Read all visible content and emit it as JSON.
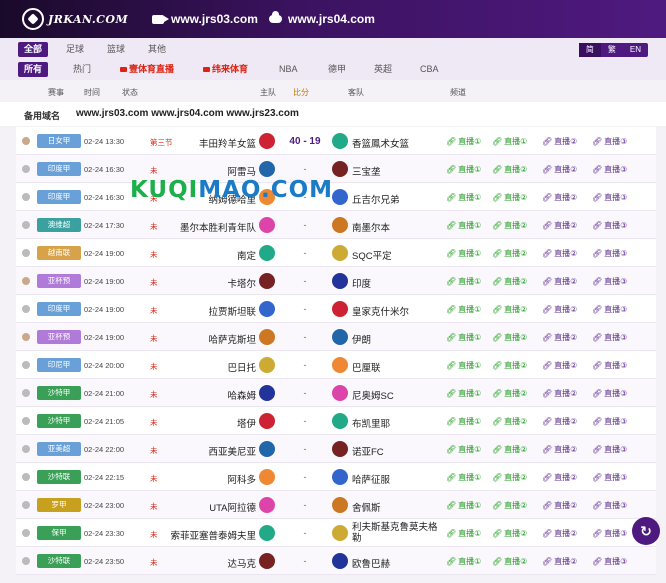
{
  "header": {
    "logo_text": "JRKAN.COM",
    "links": [
      {
        "icon": "video-camera-icon",
        "text": "www.jrs03.com"
      },
      {
        "icon": "cloud-icon",
        "text": "www.jrs04.com"
      }
    ]
  },
  "nav": {
    "sport_tabs": [
      "全部",
      "足球",
      "篮球",
      "其他"
    ],
    "sport_active": 0,
    "filter_tabs": [
      "所有",
      "热门",
      "壹体育直播",
      "纬来体育",
      "NBA",
      "德甲",
      "英超",
      "CBA"
    ],
    "lang": [
      "简",
      "繁",
      "EN"
    ]
  },
  "table": {
    "headers": [
      "赛事",
      "时间",
      "状态",
      "主队",
      "比分",
      "客队",
      "频道"
    ],
    "domains_label": "备用域名",
    "domains_value": "www.jrs03.com www.jrs04.com www.jrs23.com",
    "rows": [
      {
        "league": "日女甲",
        "color": "#6aa0d8",
        "time": "02-24 13:30",
        "status": "第三节",
        "home": "丰田羚羊女篮",
        "score": "40 - 19",
        "away": "香篮鳳术女篮",
        "live": true,
        "ball": "b",
        "links": [
          "直播①",
          "直播①",
          "直播②",
          "直播③"
        ]
      },
      {
        "league": "印度甲",
        "color": "#6aa0d8",
        "time": "02-24 16:30",
        "status": "未",
        "home": "阿雷马",
        "score": "-",
        "away": "三宝垄",
        "ball": "f",
        "links": [
          "直播①",
          "直播②",
          "直播②",
          "直播③"
        ]
      },
      {
        "league": "印度甲",
        "color": "#6aa0d8",
        "time": "02-24 16:30",
        "status": "未",
        "home": "纳姆德哈里",
        "score": "-",
        "away": "丘吉尔兄弟",
        "ball": "f",
        "links": [
          "直播①",
          "直播②",
          "直播②",
          "直播③"
        ]
      },
      {
        "league": "澳维超",
        "color": "#3aa0a0",
        "time": "02-24 17:30",
        "status": "未",
        "home": "墨尔本胜利青年队",
        "score": "-",
        "away": "南墨尔本",
        "ball": "f",
        "links": [
          "直播①",
          "直播②",
          "直播②",
          "直播③"
        ]
      },
      {
        "league": "越南联",
        "color": "#d8a24a",
        "time": "02-24 19:00",
        "status": "未",
        "home": "南定",
        "score": "-",
        "away": "SQC平定",
        "ball": "f",
        "links": [
          "直播①",
          "直播②",
          "直播②",
          "直播③"
        ]
      },
      {
        "league": "亚杯预",
        "color": "#b07ad8",
        "time": "02-24 19:00",
        "status": "未",
        "home": "卡塔尔",
        "score": "-",
        "away": "印度",
        "ball": "b",
        "links": [
          "直播①",
          "直播②",
          "直播②",
          "直播③"
        ]
      },
      {
        "league": "印度甲",
        "color": "#6aa0d8",
        "time": "02-24 19:00",
        "status": "未",
        "home": "拉贾斯坦联",
        "score": "-",
        "away": "皇家克什米尔",
        "ball": "f",
        "links": [
          "直播①",
          "直播②",
          "直播②",
          "直播③"
        ]
      },
      {
        "league": "亚杯预",
        "color": "#b07ad8",
        "time": "02-24 19:00",
        "status": "未",
        "home": "哈萨克斯坦",
        "score": "-",
        "away": "伊朗",
        "ball": "b",
        "links": [
          "直播①",
          "直播②",
          "直播②",
          "直播③"
        ]
      },
      {
        "league": "印尼甲",
        "color": "#6aa0d8",
        "time": "02-24 20:00",
        "status": "未",
        "home": "巴日托",
        "score": "-",
        "away": "巴厘联",
        "ball": "f",
        "links": [
          "直播①",
          "直播②",
          "直播②",
          "直播③"
        ]
      },
      {
        "league": "沙特甲",
        "color": "#3aa058",
        "time": "02-24 21:00",
        "status": "未",
        "home": "哈森姆",
        "score": "-",
        "away": "尼奥姆SC",
        "ball": "f",
        "links": [
          "直播①",
          "直播②",
          "直播②",
          "直播③"
        ]
      },
      {
        "league": "沙特甲",
        "color": "#3aa058",
        "time": "02-24 21:05",
        "status": "未",
        "home": "塔伊",
        "score": "-",
        "away": "布凯里耶",
        "ball": "f",
        "links": [
          "直播①",
          "直播②",
          "直播②",
          "直播③"
        ]
      },
      {
        "league": "亚美超",
        "color": "#6aa0d8",
        "time": "02-24 22:00",
        "status": "未",
        "home": "西亚美尼亚",
        "score": "-",
        "away": "诺亚FC",
        "ball": "f",
        "links": [
          "直播①",
          "直播②",
          "直播②",
          "直播③"
        ]
      },
      {
        "league": "沙特联",
        "color": "#3aa058",
        "time": "02-24 22:15",
        "status": "未",
        "home": "阿科多",
        "score": "-",
        "away": "哈萨征服",
        "ball": "f",
        "links": [
          "直播①",
          "直播②",
          "直播②",
          "直播③"
        ]
      },
      {
        "league": "罗甲",
        "color": "#c8a020",
        "time": "02-24 23:00",
        "status": "未",
        "home": "UTA阿拉德",
        "score": "-",
        "away": "舍佩斯",
        "ball": "f",
        "links": [
          "直播①",
          "直播②",
          "直播②",
          "直播③"
        ]
      },
      {
        "league": "保甲",
        "color": "#3aa058",
        "time": "02-24 23:30",
        "status": "未",
        "home": "索菲亚塞普泰姆夫里",
        "score": "-",
        "away": "利夫斯基克鲁莫夫格勒",
        "ball": "f",
        "links": [
          "直播①",
          "直播②",
          "直播②",
          "直播③"
        ]
      },
      {
        "league": "沙特联",
        "color": "#3aa058",
        "time": "02-24 23:50",
        "status": "未",
        "home": "达马克",
        "score": "-",
        "away": "欧鲁巴赫",
        "ball": "f",
        "links": [
          "直播①",
          "直播②",
          "直播②",
          "直播③"
        ]
      }
    ]
  },
  "watermark": {
    "a": "KUQI",
    "b": "MAO.COM"
  },
  "colors": {
    "accent": "#4f1a80",
    "live_link": "#1a9a1a",
    "status_red": "#d21"
  }
}
